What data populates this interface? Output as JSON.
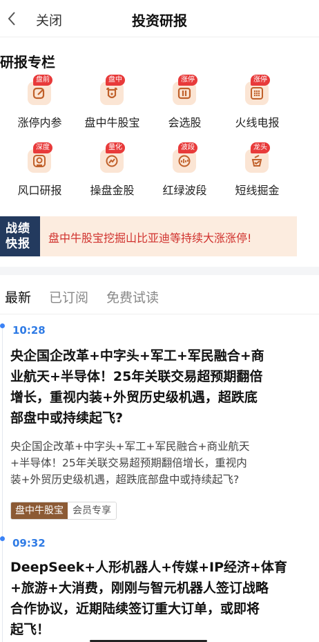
{
  "header": {
    "close_label": "关闭",
    "title": "投资研报"
  },
  "column": {
    "title": "研报专栏",
    "items": [
      {
        "label": "涨停内参",
        "badge": "盘前",
        "icon": "pen-edit-icon"
      },
      {
        "label": "盘中牛股宝",
        "badge": "盘中",
        "icon": "bull-icon"
      },
      {
        "label": "会选股",
        "badge": "涨停",
        "icon": "columns-icon"
      },
      {
        "label": "火线电报",
        "badge": "涨停",
        "icon": "grid-dots-icon"
      },
      {
        "label": "风口研报",
        "badge": "深度",
        "icon": "shield-icon"
      },
      {
        "label": "操盘金股",
        "badge": "量化",
        "icon": "chart-coin-icon"
      },
      {
        "label": "红绿波段",
        "badge": "波段",
        "icon": "wave-chart-icon"
      },
      {
        "label": "短线掘金",
        "badge": "龙头",
        "icon": "dig-icon"
      }
    ]
  },
  "banner": {
    "tag": "战绩快报",
    "tag_line1": "战绩",
    "tag_line2": "快报",
    "text": "盘中牛股宝挖掘山比亚迪等持续大涨涨停!"
  },
  "tabs": [
    {
      "label": "最新",
      "active": true
    },
    {
      "label": "已订阅",
      "active": false
    },
    {
      "label": "免费试读",
      "active": false
    }
  ],
  "feed": [
    {
      "time": "10:28",
      "headline_lines": [
        "央企国企改革+中字头+军工+军民融合+商",
        "业航天+半导体！25年关联交易超预期翻倍",
        "增长，重视内装+外贸历史级机遇，超跌底",
        "部盘中或持续起飞?"
      ],
      "summary_lines": [
        "央企国企改革+中字头+军工+军民融合+商业航天",
        "+半导体！25年关联交易超预期翻倍增长，重视内",
        "装+外贸历史级机遇，超跌底部盘中或持续起飞?"
      ],
      "tag_primary": "盘中牛股宝",
      "tag_secondary": "会员专享"
    },
    {
      "time": "09:32",
      "headline_lines": [
        "DeepSeek+人形机器人+传媒+IP经济+体育",
        "+旅游+大消费，刚刚与智元机器人签订战略",
        "合作协议，近期陆续签订重大订单，或即将",
        "起飞！"
      ]
    }
  ],
  "colors": {
    "accent_blue": "#2f7be5",
    "badge_red": "#e83a3a",
    "banner_text": "#d0312d",
    "banner_tag_bg": "#233a5e",
    "icon_bg": "#fbe5d4",
    "icon_fg": "#c0602a"
  }
}
